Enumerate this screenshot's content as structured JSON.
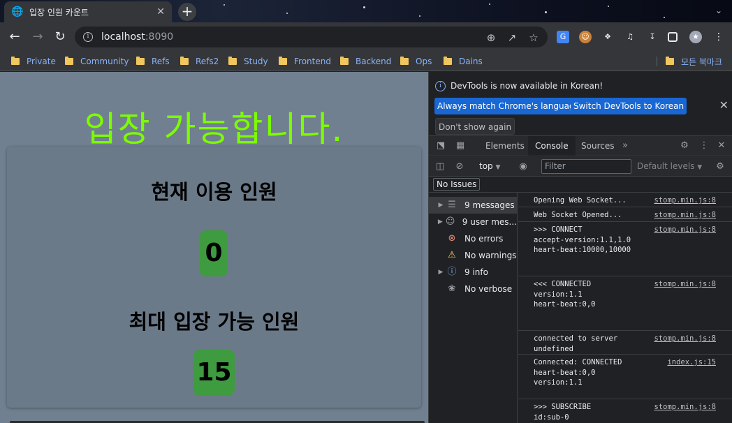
{
  "browser": {
    "tab": {
      "title": "입장 인원 카운트",
      "favicon": "globe-icon"
    },
    "address": {
      "host": "localhost",
      "port": ":8090"
    },
    "bookmarks": [
      "Private",
      "Community",
      "Refs",
      "Refs2",
      "Study",
      "Frontend",
      "Backend",
      "Ops",
      "Dains"
    ],
    "all_bookmarks": "모든 북마크"
  },
  "page": {
    "headline": "입장 가능합니다.",
    "current_label": "현재 이용 인원",
    "current_count": "0",
    "max_label": "최대 입장 가능 인원",
    "max_count": "15",
    "colors": {
      "background": "#708090",
      "headline": "#7cfc00",
      "count_badge": "#3f9b3f"
    }
  },
  "devtools": {
    "notice": {
      "message": "DevTools is now available in Korean!",
      "match_button": "Always match Chrome's language",
      "switch_button": "Switch DevTools to Korean",
      "dismiss_button": "Don't show again"
    },
    "tabs": [
      "Elements",
      "Console",
      "Sources"
    ],
    "active_tab": "Console",
    "context": "top",
    "filter_placeholder": "Filter",
    "levels": "Default levels",
    "issues_button": "No Issues",
    "sidebar": [
      {
        "label": "9 messages",
        "icon": "list-icon",
        "selected": true,
        "expandable": true
      },
      {
        "label": "9 user mes...",
        "icon": "user-icon",
        "selected": false,
        "expandable": true
      },
      {
        "label": "No errors",
        "icon": "error-icon",
        "selected": false,
        "expandable": false
      },
      {
        "label": "No warnings",
        "icon": "warning-icon",
        "selected": false,
        "expandable": false
      },
      {
        "label": "9 info",
        "icon": "info-icon",
        "selected": false,
        "expandable": true
      },
      {
        "label": "No verbose",
        "icon": "bug-icon",
        "selected": false,
        "expandable": false
      }
    ],
    "logs": [
      {
        "text": "Opening Web Socket...",
        "source": "stomp.min.js:8"
      },
      {
        "text": "Web Socket Opened...",
        "source": "stomp.min.js:8"
      },
      {
        "text": ">>> CONNECT\naccept-version:1.1,1.0\nheart-beat:10000,10000",
        "source": "stomp.min.js:8"
      },
      {
        "text": "<<< CONNECTED\nversion:1.1\nheart-beat:0,0",
        "source": "stomp.min.js:8"
      },
      {
        "text": "connected to server\nundefined",
        "source": "stomp.min.js:8"
      },
      {
        "text": "Connected: CONNECTED\nheart-beat:0,0\nversion:1.1",
        "source": "index.js:15"
      },
      {
        "text": ">>> SUBSCRIBE\nid:sub-0",
        "source": "stomp.min.js:8"
      }
    ]
  }
}
